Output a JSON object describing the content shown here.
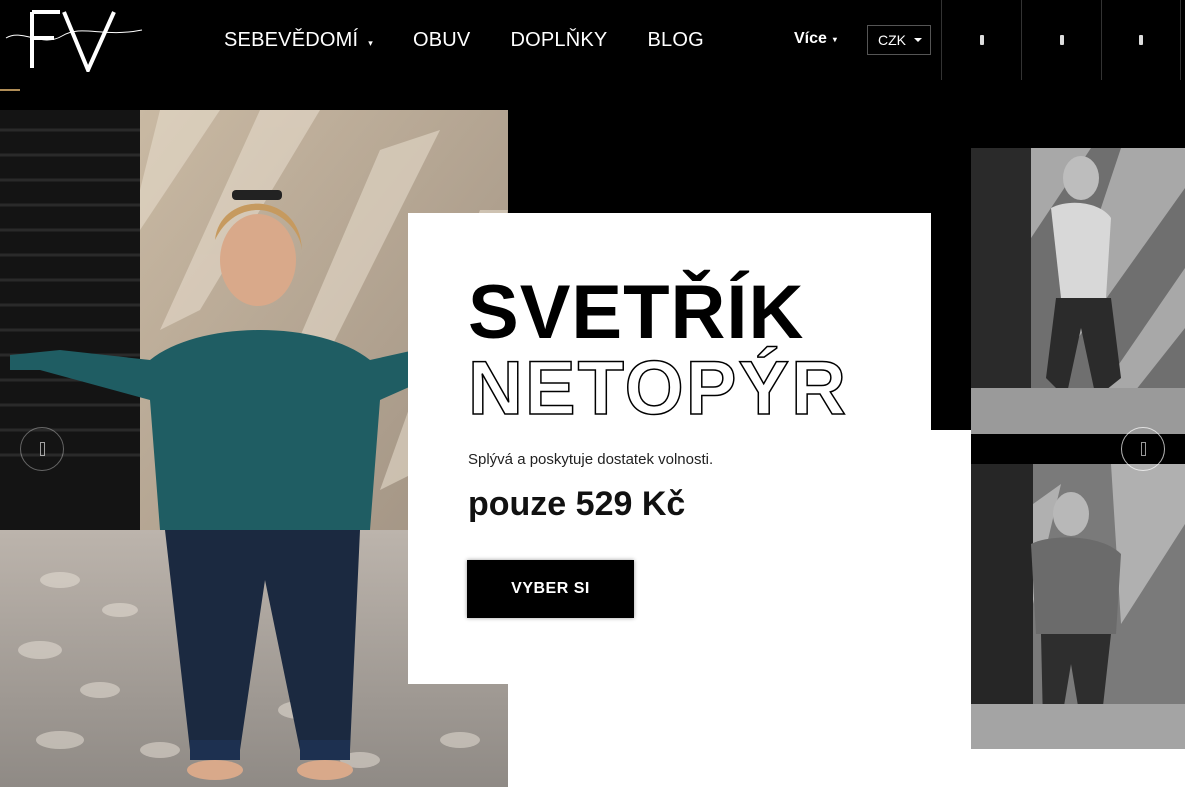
{
  "header": {
    "logo_text": "Fashion Victim",
    "logo_letters": "FV",
    "nav": [
      {
        "label": "SEBEVĚDOMÍ",
        "has_dropdown": true
      },
      {
        "label": "OBUV",
        "has_dropdown": false
      },
      {
        "label": "DOPLŇKY",
        "has_dropdown": false
      },
      {
        "label": "BLOG",
        "has_dropdown": false
      }
    ],
    "more_label": "Více",
    "currency": "CZK",
    "icons": [
      "search-icon",
      "user-icon",
      "cart-icon"
    ]
  },
  "hero": {
    "title_line1": "SVETŘÍK",
    "title_line2": "NETOPÝR",
    "subtitle": "Splývá a poskytuje dostatek volnosti.",
    "price": "pouze 529 Kč",
    "cta_label": "VYBER SI"
  },
  "colors": {
    "accent": "#b08d57",
    "background": "#000000",
    "card": "#ffffff"
  }
}
